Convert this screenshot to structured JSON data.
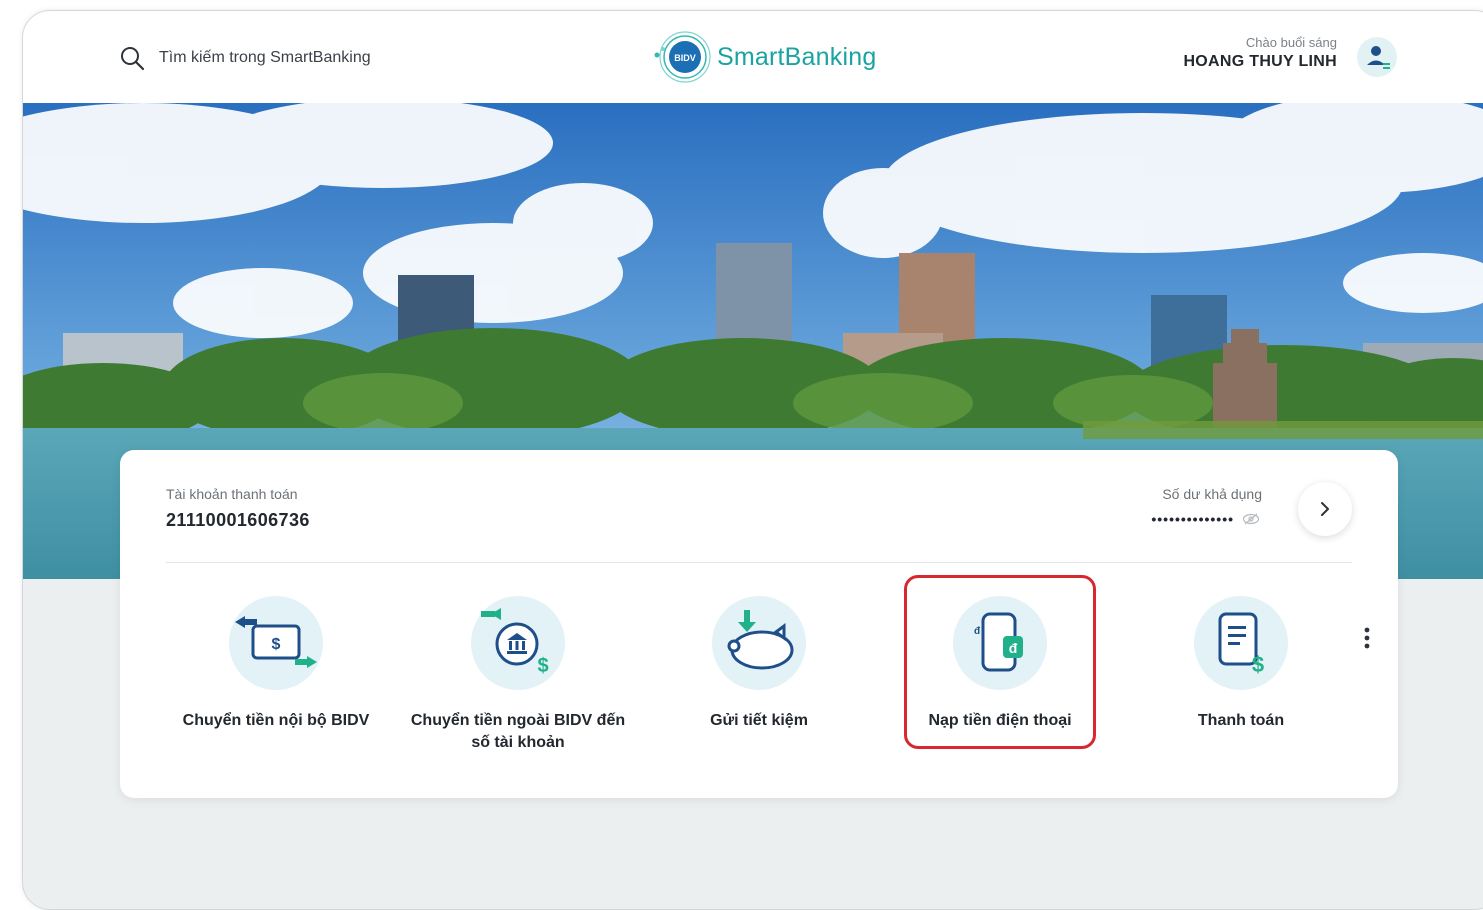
{
  "search": {
    "placeholder": "Tìm kiếm trong SmartBanking",
    "icon": "search-icon"
  },
  "logo": {
    "badge": "BIDV",
    "brand": "SmartBanking"
  },
  "greeting": {
    "hello": "Chào buổi sáng",
    "name": "HOANG THUY LINH"
  },
  "account": {
    "label": "Tài khoản thanh toán",
    "number": "21110001606736",
    "balance_label": "Số dư khả dụng",
    "balance_masked": "••••••••••••••"
  },
  "services": [
    {
      "label": "Chuyển tiền nội bộ BIDV",
      "icon": "internal-transfer-icon"
    },
    {
      "label": "Chuyển tiền ngoài BIDV đến số tài khoản",
      "icon": "external-transfer-icon"
    },
    {
      "label": "Gửi tiết kiệm",
      "icon": "savings-piggy-icon"
    },
    {
      "label": "Nạp tiền điện thoại",
      "icon": "phone-topup-icon"
    },
    {
      "label": "Thanh toán",
      "icon": "bill-payment-icon"
    }
  ],
  "colors": {
    "brand": "#1aa3a0",
    "highlight": "#d6282e",
    "icon_blue": "#1f4f8a",
    "icon_green": "#20b08a"
  }
}
